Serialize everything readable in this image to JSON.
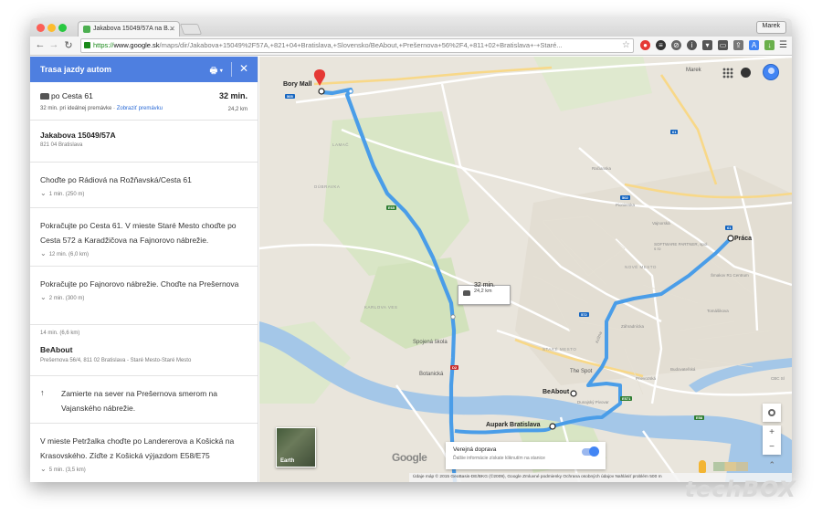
{
  "browser": {
    "tab_title": "Jakabova 15049/57A na B...",
    "user_button": "Marek",
    "url_https": "https://",
    "url_domain": "www.google.sk",
    "url_path": "/maps/dir/Jakabova+15049%2F57A,+821+04+Bratislava,+Slovensko/BeAbout,+Prešernova+56%2F4,+811+02+Bratislava+-+Staré..."
  },
  "sidebar": {
    "header_title": "Trasa jazdy autom",
    "route": {
      "via": "po Cesta 61",
      "time": "32 min.",
      "sub": "32 min. pri ideálnej premávke · ",
      "traffic_link": "Zobraziť premávku",
      "km": "24,2 km"
    },
    "origin": {
      "name": "Jakabova 15049/57A",
      "address": "821 04 Bratislava"
    },
    "steps": [
      {
        "text": "Choďte po Rádiová na Rožňavská/Cesta 61",
        "dist": "1 min. (250 m)"
      },
      {
        "text": "Pokračujte po Cesta 61. V mieste Staré Mesto choďte po Cesta 572 a Karadžičova na Fajnorovo nábrežie.",
        "dist": "12 min. (6,0 km)"
      },
      {
        "text": "Pokračujte po Fajnorovo nábrežie. Choďte na Prešernova",
        "dist": "2 min. (300 m)"
      }
    ],
    "leg_total": "14 min. (6,6 km)",
    "destination": {
      "name": "BeAbout",
      "address": "Prešernova 56/4, 811 02 Bratislava - Staré Mesto-Staré Mesto"
    },
    "step_after": "Zamierte na sever na Prešernova smerom na Vajanského nábrežie.",
    "step_last": {
      "text": "V mieste Petržalka choďte po Landererova a Košická na Krasovského. Zíďte z Košická výjazdom E58/E75",
      "dist": "5 min. (3,5 km)"
    }
  },
  "map": {
    "labels": {
      "bory_mall": "Bory Mall",
      "marek": "Marek",
      "praca": "Práca",
      "software_partner": "SOFTWARE PARTNER, spol. s ro",
      "smakov": "Šmakov R1 Centrum",
      "spojena": "Spojená škola",
      "botanicka": "Botanická",
      "the_spot": "The Spot",
      "beabout": "BeAbout",
      "dunajsky": "Dunajský Pivovar",
      "aupark": "Aupark Bratislava",
      "cbc": "CBC Sl",
      "karlova_ves": "KARLOVA VES",
      "stare_mesto": "STARÉ MESTO",
      "nove_mesto": "NOVÉ MESTO",
      "lamac": "LAMAČ",
      "dubravka": "DÚBRAVKA",
      "prievozska": "Prievozská",
      "tomasikova": "Tomášikova",
      "vajnorska": "Vajnorská",
      "zahradnicka": "Záhradnícka",
      "racianska": "Račianska",
      "pionierska": "Pionierska",
      "budovatelska": "Budovateľská",
      "kritku": "Krížna"
    },
    "route_box": {
      "time": "32 min.",
      "distance": "24,2 km"
    },
    "earth_label": "Earth",
    "transit": {
      "title": "Verejná doprava",
      "subtitle": "Ďalšie informácie získate kliknutím na stanice"
    },
    "footer": "Údaje máp © 2015 GeoBasis-DE/BKG (©2009), Google   Zmluvné podmienky   Ochrana osobných údajov   Nahlásiť problém   500 m",
    "google_logo": "Google",
    "zoom_in": "+",
    "zoom_out": "−",
    "shields": {
      "e65": "E65",
      "r1": "61",
      "r2": "61",
      "c572": "572",
      "c502": "502",
      "e58": "E58",
      "d2": "D2",
      "c505": "505",
      "e571": "E571",
      "c61": "61"
    }
  },
  "watermark": "techBOX",
  "colors": {
    "route": "#4a9de8",
    "header": "#4e7fe0",
    "water": "#a4c7e8",
    "park": "#cfe2b8"
  }
}
